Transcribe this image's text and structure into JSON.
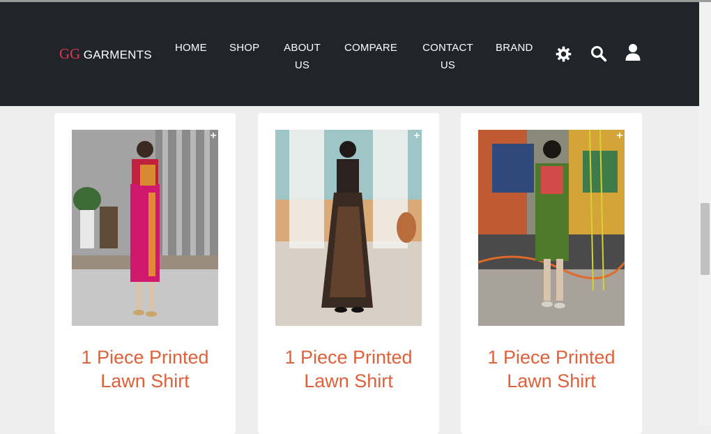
{
  "brand": {
    "prefix": "GG",
    "name": "GARMENTS"
  },
  "nav": {
    "home": "HOME",
    "shop": "SHOP",
    "about_line1": "ABOUT",
    "about_line2": "US",
    "compare": "COMPARE",
    "contact_line1": "CONTACT",
    "contact_line2": "US",
    "brand": "BRAND",
    "icons": [
      "gear-icon",
      "search-icon",
      "user-icon"
    ]
  },
  "products": [
    {
      "title_line1": "1 Piece Printed",
      "title_line2": "Lawn Shirt",
      "image": "model in pink striped kurta"
    },
    {
      "title_line1": "1 Piece Printed",
      "title_line2": "Lawn Shirt",
      "image": "model in black printed long dress"
    },
    {
      "title_line1": "1 Piece Printed",
      "title_line2": "Lawn Shirt",
      "image": "model in green floral kurta"
    }
  ],
  "colors": {
    "navbar": "#212529",
    "brand_accent": "#e0344f",
    "title": "#e0603a",
    "page_bg": "#eeeeee"
  }
}
